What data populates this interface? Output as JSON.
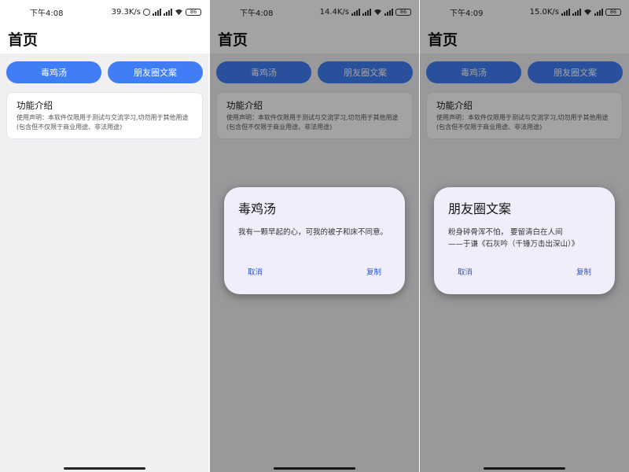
{
  "screens": [
    {
      "status": {
        "time": "下午4:08",
        "speed": "39.3K/s",
        "battery": "86"
      },
      "title": "首页",
      "buttons": {
        "left": "毒鸡汤",
        "right": "朋友圈文案"
      },
      "info": {
        "title": "功能介绍",
        "text": "使用声明：本软件仅限用于测试与交流学习,切勿用于其他用途(包含但不仅限于商业用途、非法用途)"
      }
    },
    {
      "status": {
        "time": "下午4:08",
        "speed": "14.4K/s",
        "battery": "86"
      },
      "title": "首页",
      "buttons": {
        "left": "毒鸡汤",
        "right": "朋友圈文案"
      },
      "info": {
        "title": "功能介绍",
        "text": "使用声明：本软件仅限用于测试与交流学习,切勿用于其他用途(包含但不仅限于商业用途、非法用途)"
      },
      "dialog": {
        "title": "毒鸡汤",
        "line1": "我有一颗早起的心，可我的被子和床不同意。",
        "line2": "",
        "cancel": "取消",
        "copy": "复制"
      }
    },
    {
      "status": {
        "time": "下午4:09",
        "speed": "15.0K/s",
        "battery": "86"
      },
      "title": "首页",
      "buttons": {
        "left": "毒鸡汤",
        "right": "朋友圈文案"
      },
      "info": {
        "title": "功能介绍",
        "text": "使用声明：本软件仅限用于测试与交流学习,切勿用于其他用途(包含但不仅限于商业用途、非法用途)"
      },
      "dialog": {
        "title": "朋友圈文案",
        "line1": "粉身碎骨浑不怕， 要留清白在人间",
        "line2": "——于谦《石灰吟（千锤万击出深山）》",
        "cancel": "取消",
        "copy": "复制"
      }
    }
  ]
}
